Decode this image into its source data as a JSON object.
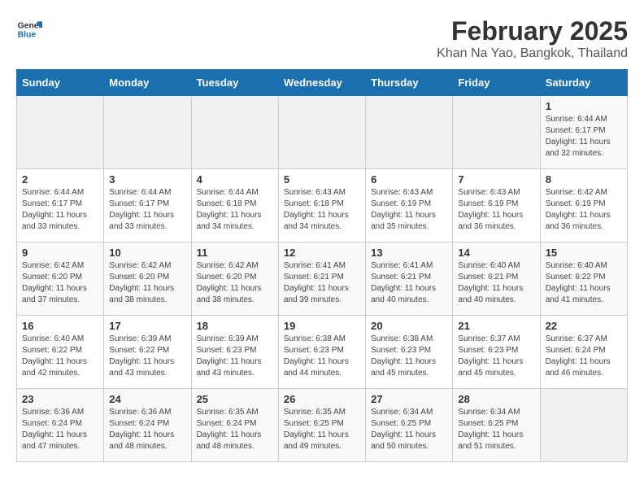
{
  "logo": {
    "line1": "General",
    "line2": "Blue"
  },
  "title": "February 2025",
  "subtitle": "Khan Na Yao, Bangkok, Thailand",
  "days_of_week": [
    "Sunday",
    "Monday",
    "Tuesday",
    "Wednesday",
    "Thursday",
    "Friday",
    "Saturday"
  ],
  "weeks": [
    [
      {
        "day": "",
        "info": ""
      },
      {
        "day": "",
        "info": ""
      },
      {
        "day": "",
        "info": ""
      },
      {
        "day": "",
        "info": ""
      },
      {
        "day": "",
        "info": ""
      },
      {
        "day": "",
        "info": ""
      },
      {
        "day": "1",
        "info": "Sunrise: 6:44 AM\nSunset: 6:17 PM\nDaylight: 11 hours and 32 minutes."
      }
    ],
    [
      {
        "day": "2",
        "info": "Sunrise: 6:44 AM\nSunset: 6:17 PM\nDaylight: 11 hours and 33 minutes."
      },
      {
        "day": "3",
        "info": "Sunrise: 6:44 AM\nSunset: 6:17 PM\nDaylight: 11 hours and 33 minutes."
      },
      {
        "day": "4",
        "info": "Sunrise: 6:44 AM\nSunset: 6:18 PM\nDaylight: 11 hours and 34 minutes."
      },
      {
        "day": "5",
        "info": "Sunrise: 6:43 AM\nSunset: 6:18 PM\nDaylight: 11 hours and 34 minutes."
      },
      {
        "day": "6",
        "info": "Sunrise: 6:43 AM\nSunset: 6:19 PM\nDaylight: 11 hours and 35 minutes."
      },
      {
        "day": "7",
        "info": "Sunrise: 6:43 AM\nSunset: 6:19 PM\nDaylight: 11 hours and 36 minutes."
      },
      {
        "day": "8",
        "info": "Sunrise: 6:42 AM\nSunset: 6:19 PM\nDaylight: 11 hours and 36 minutes."
      }
    ],
    [
      {
        "day": "9",
        "info": "Sunrise: 6:42 AM\nSunset: 6:20 PM\nDaylight: 11 hours and 37 minutes."
      },
      {
        "day": "10",
        "info": "Sunrise: 6:42 AM\nSunset: 6:20 PM\nDaylight: 11 hours and 38 minutes."
      },
      {
        "day": "11",
        "info": "Sunrise: 6:42 AM\nSunset: 6:20 PM\nDaylight: 11 hours and 38 minutes."
      },
      {
        "day": "12",
        "info": "Sunrise: 6:41 AM\nSunset: 6:21 PM\nDaylight: 11 hours and 39 minutes."
      },
      {
        "day": "13",
        "info": "Sunrise: 6:41 AM\nSunset: 6:21 PM\nDaylight: 11 hours and 40 minutes."
      },
      {
        "day": "14",
        "info": "Sunrise: 6:40 AM\nSunset: 6:21 PM\nDaylight: 11 hours and 40 minutes."
      },
      {
        "day": "15",
        "info": "Sunrise: 6:40 AM\nSunset: 6:22 PM\nDaylight: 11 hours and 41 minutes."
      }
    ],
    [
      {
        "day": "16",
        "info": "Sunrise: 6:40 AM\nSunset: 6:22 PM\nDaylight: 11 hours and 42 minutes."
      },
      {
        "day": "17",
        "info": "Sunrise: 6:39 AM\nSunset: 6:22 PM\nDaylight: 11 hours and 43 minutes."
      },
      {
        "day": "18",
        "info": "Sunrise: 6:39 AM\nSunset: 6:23 PM\nDaylight: 11 hours and 43 minutes."
      },
      {
        "day": "19",
        "info": "Sunrise: 6:38 AM\nSunset: 6:23 PM\nDaylight: 11 hours and 44 minutes."
      },
      {
        "day": "20",
        "info": "Sunrise: 6:38 AM\nSunset: 6:23 PM\nDaylight: 11 hours and 45 minutes."
      },
      {
        "day": "21",
        "info": "Sunrise: 6:37 AM\nSunset: 6:23 PM\nDaylight: 11 hours and 45 minutes."
      },
      {
        "day": "22",
        "info": "Sunrise: 6:37 AM\nSunset: 6:24 PM\nDaylight: 11 hours and 46 minutes."
      }
    ],
    [
      {
        "day": "23",
        "info": "Sunrise: 6:36 AM\nSunset: 6:24 PM\nDaylight: 11 hours and 47 minutes."
      },
      {
        "day": "24",
        "info": "Sunrise: 6:36 AM\nSunset: 6:24 PM\nDaylight: 11 hours and 48 minutes."
      },
      {
        "day": "25",
        "info": "Sunrise: 6:35 AM\nSunset: 6:24 PM\nDaylight: 11 hours and 48 minutes."
      },
      {
        "day": "26",
        "info": "Sunrise: 6:35 AM\nSunset: 6:25 PM\nDaylight: 11 hours and 49 minutes."
      },
      {
        "day": "27",
        "info": "Sunrise: 6:34 AM\nSunset: 6:25 PM\nDaylight: 11 hours and 50 minutes."
      },
      {
        "day": "28",
        "info": "Sunrise: 6:34 AM\nSunset: 6:25 PM\nDaylight: 11 hours and 51 minutes."
      },
      {
        "day": "",
        "info": ""
      }
    ]
  ]
}
